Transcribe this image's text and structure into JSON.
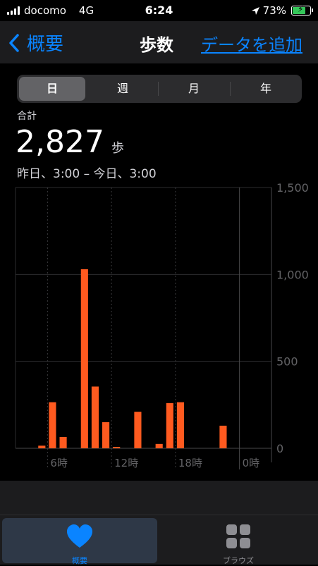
{
  "status": {
    "carrier": "docomo",
    "network": "4G",
    "time": "6:24",
    "battery": "73%",
    "battery_level": 0.73
  },
  "nav": {
    "back_label": "概要",
    "title": "歩数",
    "add_label": "データを追加"
  },
  "segments": [
    "日",
    "週",
    "月",
    "年"
  ],
  "summary": {
    "label": "合計",
    "value": "2,827",
    "unit": "歩",
    "range": "昨日、3:00 – 今日、3:00"
  },
  "chart_data": {
    "type": "bar",
    "x": [
      3,
      4,
      5,
      6,
      7,
      8,
      9,
      10,
      11,
      12,
      13,
      14,
      15,
      16,
      17,
      18,
      19,
      20,
      21,
      22,
      23,
      0,
      1,
      2
    ],
    "x_ticks": [
      "6時",
      "12時",
      "18時",
      "0時"
    ],
    "values": [
      0,
      0,
      15,
      265,
      65,
      0,
      1030,
      355,
      150,
      5,
      0,
      210,
      0,
      25,
      260,
      265,
      0,
      0,
      0,
      130,
      0,
      0,
      0,
      0
    ],
    "ylim": [
      0,
      1500
    ],
    "y_ticks": [
      "1,500",
      "1,000",
      "500",
      "0"
    ],
    "bar_color": "#ff5a1f"
  },
  "tabs": [
    {
      "label": "概要",
      "icon": "heart-icon"
    },
    {
      "label": "ブラウズ",
      "icon": "grid-icon"
    }
  ]
}
